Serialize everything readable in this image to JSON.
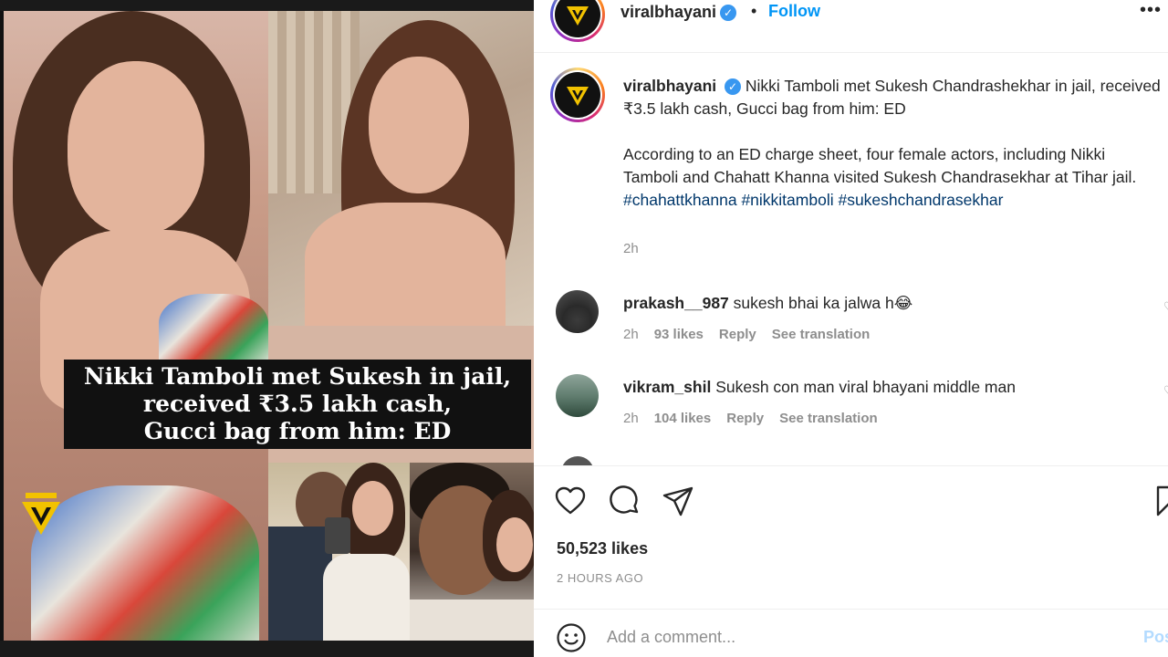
{
  "post": {
    "username": "viralbhayani",
    "verified": true,
    "dot": "•",
    "follow_label": "Follow",
    "more_label": "•••"
  },
  "media": {
    "headline_lines": [
      "Nikki Tamboli met Sukesh in jail,",
      "received ₹3.5 lakh cash,",
      "Gucci bag from him: ED"
    ]
  },
  "caption": {
    "username": "viralbhayani",
    "line1": "Nikki Tamboli met Sukesh Chandrashekhar in jail, received ₹3.5 lakh cash, Gucci bag from him: ED",
    "body": "According to an ED charge sheet, four female actors, including Nikki Tamboli and Chahatt Khanna visited Sukesh Chandrasekhar at Tihar jail.",
    "tags": [
      "#chahattkhanna",
      "#nikkitamboli",
      "#sukeshchandrasekhar"
    ],
    "time": "2h"
  },
  "comments": [
    {
      "username": "prakash__987",
      "text": "sukesh bhai ka jalwa h😂",
      "time": "2h",
      "likes": "93 likes",
      "reply": "Reply",
      "translate": "See translation"
    },
    {
      "username": "vikram_shil",
      "text": "Sukesh con man viral bhayani middle man",
      "time": "2h",
      "likes": "104 likes",
      "reply": "Reply",
      "translate": "See translation"
    }
  ],
  "actions": {
    "icons": [
      "heart-icon",
      "comment-icon",
      "share-icon",
      "bookmark-icon"
    ],
    "likes_count": "50,523 likes",
    "timestamp": "2 HOURS AGO"
  },
  "add_comment": {
    "placeholder": "Add a comment...",
    "post_label": "Post"
  },
  "colors": {
    "link": "#00376b",
    "follow": "#0095f6",
    "muted": "#8e8e8e",
    "verified": "#3897f0"
  }
}
